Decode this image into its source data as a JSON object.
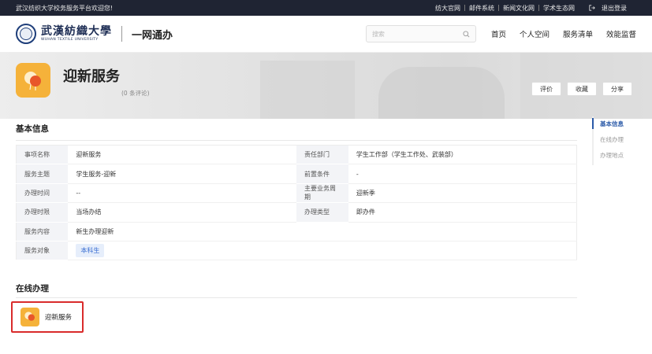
{
  "topbar": {
    "welcome": "武汉纺织大学校务服务平台欢迎您!",
    "links": [
      "纺大官网",
      "邮件系统",
      "新闻文化网",
      "学术生态网"
    ],
    "logout": "退出登录"
  },
  "header": {
    "logo_cn": "武漢紡織大學",
    "logo_en": "WUHAN TEXTILE UNIVERSITY",
    "site_name": "一网通办",
    "search_placeholder": "搜索",
    "nav": [
      "首页",
      "个人空间",
      "服务清单",
      "效能监督"
    ]
  },
  "hero": {
    "title": "迎新服务",
    "comments": "(0 条评论)",
    "actions": [
      "评价",
      "收藏",
      "分享"
    ]
  },
  "basic_info": {
    "title": "基本信息",
    "rows": [
      {
        "k1": "事项名称",
        "v1": "迎新服务",
        "k2": "责任部门",
        "v2": "学生工作部（学生工作处、武装部）"
      },
      {
        "k1": "服务主题",
        "v1": "学生服务-迎新",
        "k2": "前置条件",
        "v2": "-"
      },
      {
        "k1": "办理时间",
        "v1": "--",
        "k2": "主要业务周期",
        "v2": "迎新季"
      },
      {
        "k1": "办理时限",
        "v1": "当场办结",
        "k2": "办理类型",
        "v2": "即办件"
      },
      {
        "k1": "服务内容",
        "v1": "新生办理迎新"
      },
      {
        "k1": "服务对象",
        "tag": "本科生"
      }
    ]
  },
  "online": {
    "title": "在线办理",
    "item_label": "迎新服务"
  },
  "sidebar": {
    "items": [
      "基本信息",
      "在线办理",
      "办理地点"
    ]
  },
  "colors": {
    "topbar_bg": "#1f2433",
    "accent": "#2b5aa8",
    "icon_orange": "#f5b23a",
    "highlight_red": "#d92b2b"
  }
}
